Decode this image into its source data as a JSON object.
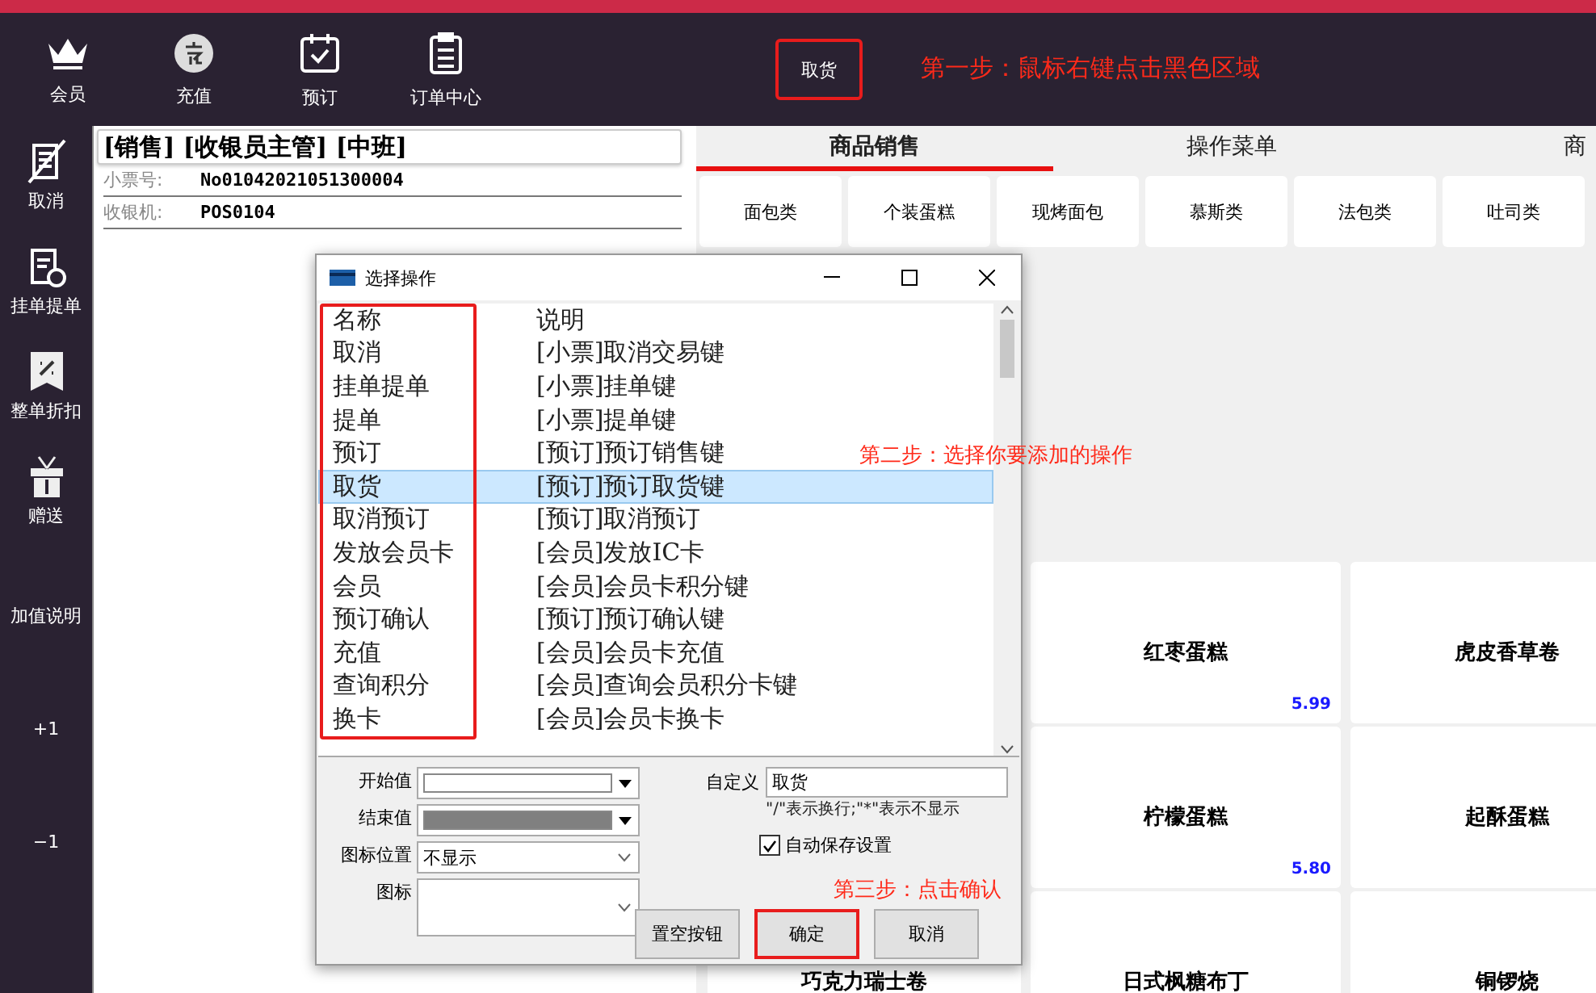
{
  "toolbar": {
    "items": [
      {
        "label": "会员"
      },
      {
        "label": "充值"
      },
      {
        "label": "预订"
      },
      {
        "label": "订单中心"
      }
    ],
    "custom_button": {
      "label": "取货",
      "highlighted": true
    }
  },
  "sidebar": {
    "items": [
      {
        "label": "取消"
      },
      {
        "label": "挂单提单"
      },
      {
        "label": "整单折扣"
      },
      {
        "label": "赠送"
      },
      {
        "label": "加值说明"
      },
      {
        "label": "+1"
      },
      {
        "label": "−1"
      }
    ]
  },
  "ticket": {
    "header": "[销售] [收银员主管] [中班]",
    "fields": [
      {
        "label": "小票号:",
        "value": "No01042021051300004"
      },
      {
        "label": "收银机:",
        "value": "POS0104"
      }
    ]
  },
  "tabs": [
    {
      "label": "商品销售",
      "selected": true
    },
    {
      "label": "操作菜单",
      "selected": false
    },
    {
      "label": "商",
      "selected": false
    }
  ],
  "categories": [
    "面包类",
    "个装蛋糕",
    "现烤面包",
    "慕斯类",
    "法包类",
    "吐司类"
  ],
  "products": [
    {
      "name": "红枣蛋糕",
      "price": "5.99"
    },
    {
      "name": "虎皮香草卷"
    },
    {
      "name": "柠檬蛋糕",
      "price": "5.80"
    },
    {
      "name": "起酥蛋糕"
    },
    {
      "name": "巧克力瑞士卷"
    },
    {
      "name": "日式枫糖布丁"
    },
    {
      "name": "铜锣烧"
    }
  ],
  "dialog": {
    "title": "选择操作",
    "columns": [
      "名称",
      "说明"
    ],
    "names_highlighted": true,
    "rows": [
      {
        "name": "取消",
        "description": "[小票]取消交易键",
        "selected": false
      },
      {
        "name": "挂单提单",
        "description": "[小票]挂单键",
        "selected": false
      },
      {
        "name": "提单",
        "description": "[小票]提单键",
        "selected": false
      },
      {
        "name": "预订",
        "description": "[预订]预订销售键",
        "selected": false
      },
      {
        "name": "取货",
        "description": "[预订]预订取货键",
        "selected": true
      },
      {
        "name": "取消预订",
        "description": "[预订]取消预订",
        "selected": false
      },
      {
        "name": "发放会员卡",
        "description": "[会员]发放IC卡",
        "selected": false
      },
      {
        "name": "会员",
        "description": "[会员]会员卡积分键",
        "selected": false
      },
      {
        "name": "预订确认",
        "description": "[预订]预订确认键",
        "selected": false
      },
      {
        "name": "充值",
        "description": "[会员]会员卡充值",
        "selected": false
      },
      {
        "name": "查询积分",
        "description": "[会员]查询会员积分卡键",
        "selected": false
      },
      {
        "name": "换卡",
        "description": "[会员]会员卡换卡",
        "selected": false
      }
    ],
    "color_fields": [
      {
        "label": "开始值",
        "color": "#ffffff"
      },
      {
        "label": "结束值",
        "color": "#808080"
      }
    ],
    "icon_position": {
      "label": "图标位置",
      "value": "不显示"
    },
    "icon_field": {
      "label": "图标"
    },
    "custom": {
      "label": "自定义",
      "value": "取货",
      "hint": "\"/\"表示换行;\"*\"表示不显示"
    },
    "autosave": {
      "label": "自动保存设置",
      "checked": true
    },
    "buttons": [
      {
        "label": "置空按钮",
        "highlighted": false
      },
      {
        "label": "确定",
        "highlighted": true
      },
      {
        "label": "取消",
        "highlighted": false
      }
    ]
  },
  "annotations": [
    "第一步：鼠标右键点击黑色区域",
    "第二步：选择你要添加的操作",
    "第三步：点击确认"
  ]
}
